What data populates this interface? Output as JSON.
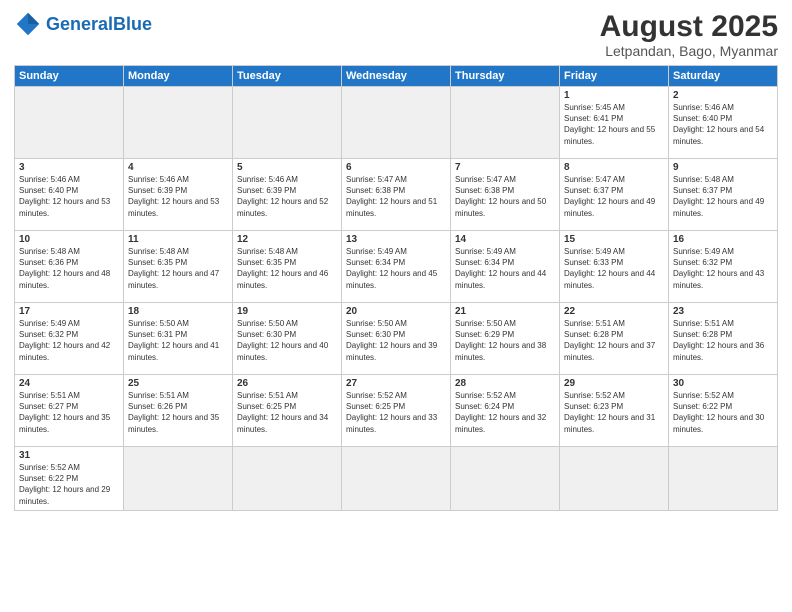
{
  "header": {
    "logo_general": "General",
    "logo_blue": "Blue",
    "title": "August 2025",
    "subtitle": "Letpandan, Bago, Myanmar"
  },
  "days_of_week": [
    "Sunday",
    "Monday",
    "Tuesday",
    "Wednesday",
    "Thursday",
    "Friday",
    "Saturday"
  ],
  "weeks": [
    [
      {
        "day": "",
        "empty": true
      },
      {
        "day": "",
        "empty": true
      },
      {
        "day": "",
        "empty": true
      },
      {
        "day": "",
        "empty": true
      },
      {
        "day": "",
        "empty": true
      },
      {
        "day": "1",
        "sunrise": "5:45 AM",
        "sunset": "6:41 PM",
        "daylight": "12 hours and 55 minutes."
      },
      {
        "day": "2",
        "sunrise": "5:46 AM",
        "sunset": "6:40 PM",
        "daylight": "12 hours and 54 minutes."
      }
    ],
    [
      {
        "day": "3",
        "sunrise": "5:46 AM",
        "sunset": "6:40 PM",
        "daylight": "12 hours and 53 minutes."
      },
      {
        "day": "4",
        "sunrise": "5:46 AM",
        "sunset": "6:39 PM",
        "daylight": "12 hours and 53 minutes."
      },
      {
        "day": "5",
        "sunrise": "5:46 AM",
        "sunset": "6:39 PM",
        "daylight": "12 hours and 52 minutes."
      },
      {
        "day": "6",
        "sunrise": "5:47 AM",
        "sunset": "6:38 PM",
        "daylight": "12 hours and 51 minutes."
      },
      {
        "day": "7",
        "sunrise": "5:47 AM",
        "sunset": "6:38 PM",
        "daylight": "12 hours and 50 minutes."
      },
      {
        "day": "8",
        "sunrise": "5:47 AM",
        "sunset": "6:37 PM",
        "daylight": "12 hours and 49 minutes."
      },
      {
        "day": "9",
        "sunrise": "5:48 AM",
        "sunset": "6:37 PM",
        "daylight": "12 hours and 49 minutes."
      }
    ],
    [
      {
        "day": "10",
        "sunrise": "5:48 AM",
        "sunset": "6:36 PM",
        "daylight": "12 hours and 48 minutes."
      },
      {
        "day": "11",
        "sunrise": "5:48 AM",
        "sunset": "6:35 PM",
        "daylight": "12 hours and 47 minutes."
      },
      {
        "day": "12",
        "sunrise": "5:48 AM",
        "sunset": "6:35 PM",
        "daylight": "12 hours and 46 minutes."
      },
      {
        "day": "13",
        "sunrise": "5:49 AM",
        "sunset": "6:34 PM",
        "daylight": "12 hours and 45 minutes."
      },
      {
        "day": "14",
        "sunrise": "5:49 AM",
        "sunset": "6:34 PM",
        "daylight": "12 hours and 44 minutes."
      },
      {
        "day": "15",
        "sunrise": "5:49 AM",
        "sunset": "6:33 PM",
        "daylight": "12 hours and 44 minutes."
      },
      {
        "day": "16",
        "sunrise": "5:49 AM",
        "sunset": "6:32 PM",
        "daylight": "12 hours and 43 minutes."
      }
    ],
    [
      {
        "day": "17",
        "sunrise": "5:49 AM",
        "sunset": "6:32 PM",
        "daylight": "12 hours and 42 minutes."
      },
      {
        "day": "18",
        "sunrise": "5:50 AM",
        "sunset": "6:31 PM",
        "daylight": "12 hours and 41 minutes."
      },
      {
        "day": "19",
        "sunrise": "5:50 AM",
        "sunset": "6:30 PM",
        "daylight": "12 hours and 40 minutes."
      },
      {
        "day": "20",
        "sunrise": "5:50 AM",
        "sunset": "6:30 PM",
        "daylight": "12 hours and 39 minutes."
      },
      {
        "day": "21",
        "sunrise": "5:50 AM",
        "sunset": "6:29 PM",
        "daylight": "12 hours and 38 minutes."
      },
      {
        "day": "22",
        "sunrise": "5:51 AM",
        "sunset": "6:28 PM",
        "daylight": "12 hours and 37 minutes."
      },
      {
        "day": "23",
        "sunrise": "5:51 AM",
        "sunset": "6:28 PM",
        "daylight": "12 hours and 36 minutes."
      }
    ],
    [
      {
        "day": "24",
        "sunrise": "5:51 AM",
        "sunset": "6:27 PM",
        "daylight": "12 hours and 35 minutes."
      },
      {
        "day": "25",
        "sunrise": "5:51 AM",
        "sunset": "6:26 PM",
        "daylight": "12 hours and 35 minutes."
      },
      {
        "day": "26",
        "sunrise": "5:51 AM",
        "sunset": "6:25 PM",
        "daylight": "12 hours and 34 minutes."
      },
      {
        "day": "27",
        "sunrise": "5:52 AM",
        "sunset": "6:25 PM",
        "daylight": "12 hours and 33 minutes."
      },
      {
        "day": "28",
        "sunrise": "5:52 AM",
        "sunset": "6:24 PM",
        "daylight": "12 hours and 32 minutes."
      },
      {
        "day": "29",
        "sunrise": "5:52 AM",
        "sunset": "6:23 PM",
        "daylight": "12 hours and 31 minutes."
      },
      {
        "day": "30",
        "sunrise": "5:52 AM",
        "sunset": "6:22 PM",
        "daylight": "12 hours and 30 minutes."
      }
    ],
    [
      {
        "day": "31",
        "sunrise": "5:52 AM",
        "sunset": "6:22 PM",
        "daylight": "12 hours and 29 minutes."
      },
      {
        "day": "",
        "empty": true
      },
      {
        "day": "",
        "empty": true
      },
      {
        "day": "",
        "empty": true
      },
      {
        "day": "",
        "empty": true
      },
      {
        "day": "",
        "empty": true
      },
      {
        "day": "",
        "empty": true
      }
    ]
  ]
}
